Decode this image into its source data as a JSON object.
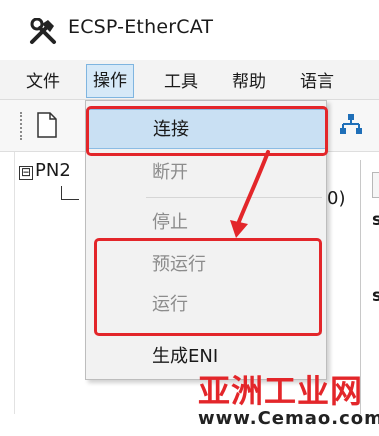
{
  "window": {
    "title": "ECSP-EtherCAT",
    "app_icon": "tools-icon"
  },
  "menubar": {
    "items": [
      {
        "label": "文件",
        "active": false
      },
      {
        "label": "操作",
        "active": true
      },
      {
        "label": "工具",
        "active": false
      },
      {
        "label": "帮助",
        "active": false
      },
      {
        "label": "语言",
        "active": false
      }
    ]
  },
  "toolbar": {
    "icons": [
      "new-document-icon",
      "network-icon"
    ]
  },
  "tree": {
    "root_label": "PN2",
    "expander": "⊟",
    "child_peek": "0)"
  },
  "right_panel": {
    "labels": [
      "s",
      "s"
    ]
  },
  "dropdown": {
    "items": [
      {
        "label": "连接",
        "enabled": true,
        "hover": true
      },
      {
        "label": "断开",
        "enabled": false
      },
      {
        "label": "停止",
        "enabled": false
      },
      {
        "label": "预运行",
        "enabled": false
      },
      {
        "label": "运行",
        "enabled": false
      },
      {
        "label": "生成ENI",
        "enabled": true
      }
    ]
  },
  "annotations": {
    "highlight_color": "#e3262a"
  },
  "watermark": {
    "site_name": "亚洲工业网",
    "url": "www.Cemao.com"
  }
}
